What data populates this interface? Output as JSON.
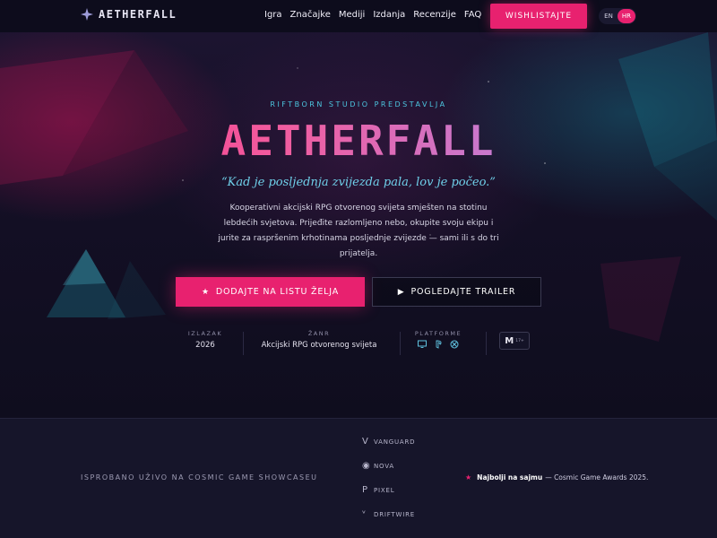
{
  "nav": {
    "logo": "AETHERFALL",
    "links": [
      "Igra",
      "Značajke",
      "Mediji",
      "Izdanja",
      "Recenzije",
      "FAQ"
    ],
    "cta": "WISHLISTAJTE",
    "languages": [
      {
        "code": "EN",
        "active": false
      },
      {
        "code": "HR",
        "active": true
      }
    ]
  },
  "hero": {
    "eyebrow": "RIFTBORN STUDIO PREDSTAVLJA",
    "title": "AETHERFALL",
    "tagline": "“Kad je posljednja zvijezda pala, lov je počeo.”",
    "description": "Kooperativni akcijski RPG otvorenog svijeta smješten na stotinu lebdećih svjetova. Prijeđite razlomljeno nebo, okupite svoju ekipu i jurite za raspršenim krhotinama posljednje zvijezde — sami ili s do tri prijatelja.",
    "primary_button": "DODAJTE NA LISTU ŽELJA",
    "secondary_button": "POGLEDAJTE TRAILER",
    "meta": {
      "release_label": "IZLAZAK",
      "release_value": "2026",
      "genre_label": "ŽANR",
      "genre_value": "Akcijski RPG otvorenog svijeta",
      "platforms_label": "PLATFORME",
      "platform_icons": [
        "monitor-icon",
        "playstation-icon",
        "xbox-icon"
      ],
      "rating": "M",
      "rating_sub": "17+"
    }
  },
  "strip": {
    "label": "ISPROBANO UŽIVO NA COSMIC GAME SHOWCASEU",
    "outlets": [
      {
        "mark": "V",
        "name": "VANGUARD"
      },
      {
        "mark": "◉",
        "name": "NOVA"
      },
      {
        "mark": "P",
        "name": "PIXEL"
      },
      {
        "mark": "ᵛ",
        "name": "DRIFTWIRE"
      }
    ],
    "award_strong": "Najbolji na sajmu",
    "award_rest": "— Cosmic Game Awards 2025."
  },
  "colors": {
    "accent": "#e8216f",
    "cyan": "#4cc6e0",
    "background": "#0b0a1a"
  }
}
